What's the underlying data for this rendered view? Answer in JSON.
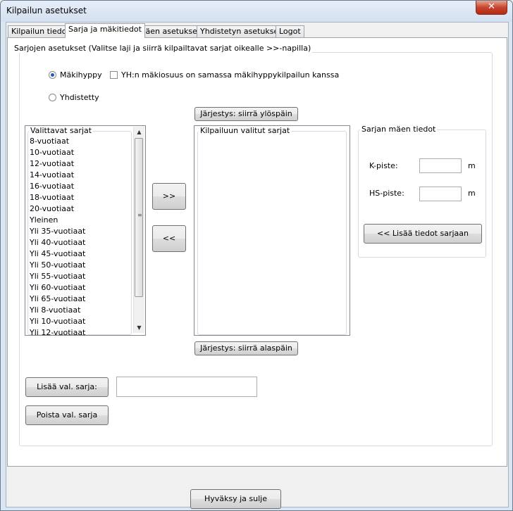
{
  "window": {
    "title": "Kilpailun asetukset",
    "close_symbol": "✕"
  },
  "tabs": [
    "Kilpailun tiedot",
    "Sarja ja mäkitiedot",
    "Mäen asetukset",
    "Yhdistetyn asetukset",
    "Logot"
  ],
  "active_tab": 1,
  "series_group": {
    "label": "Sarjojen asetukset (Valitse laji ja siirrä kilpailtavat sarjat oikealle >>-napilla)"
  },
  "sport_options": {
    "makihyppy": "Mäkihyppy",
    "yhdistetty": "Yhdistetty",
    "selected": "Mäkihyppy"
  },
  "yh_checkbox_label": "YH:n mäkiosuus on samassa mäkihyppykilpailun kanssa",
  "order_up_label": "Järjestys: siirrä ylöspäin",
  "order_down_label": "Järjestys: siirrä alaspäin",
  "available_list": {
    "label": "Valittavat sarjat",
    "items": [
      "8-vuotiaat",
      "10-vuotiaat",
      "12-vuotiaat",
      "14-vuotiaat",
      "16-vuotiaat",
      "18-vuotiaat",
      "20-vuotiaat",
      "Yleinen",
      "Yli 35-vuotiaat",
      "Yli 40-vuotiaat",
      "Yli 45-vuotiaat",
      "Yli 50-vuotiaat",
      "Yli 55-vuotiaat",
      "Yli 60-vuotiaat",
      "Yli 65-vuotiaat",
      "Yli 8-vuotiaat",
      "Yli 10-vuotiaat",
      "Yli 12-vuotiaat"
    ]
  },
  "move_right_label": ">>",
  "move_left_label": "<<",
  "selected_list": {
    "label": "Kilpailuun valitut sarjat",
    "items": []
  },
  "hill_info": {
    "label": "Sarjan mäen tiedot",
    "k_point_label": "K-piste:",
    "k_point_value": "",
    "hs_point_label": "HS-piste:",
    "hs_point_value": "",
    "unit": "m",
    "add_button": "<< Lisää tiedot sarjaan"
  },
  "add_series_button": "Lisää val. sarja:",
  "add_series_value": "",
  "remove_series_button": "Poista val. sarja",
  "confirm_button": "Hyväksy ja sulje"
}
